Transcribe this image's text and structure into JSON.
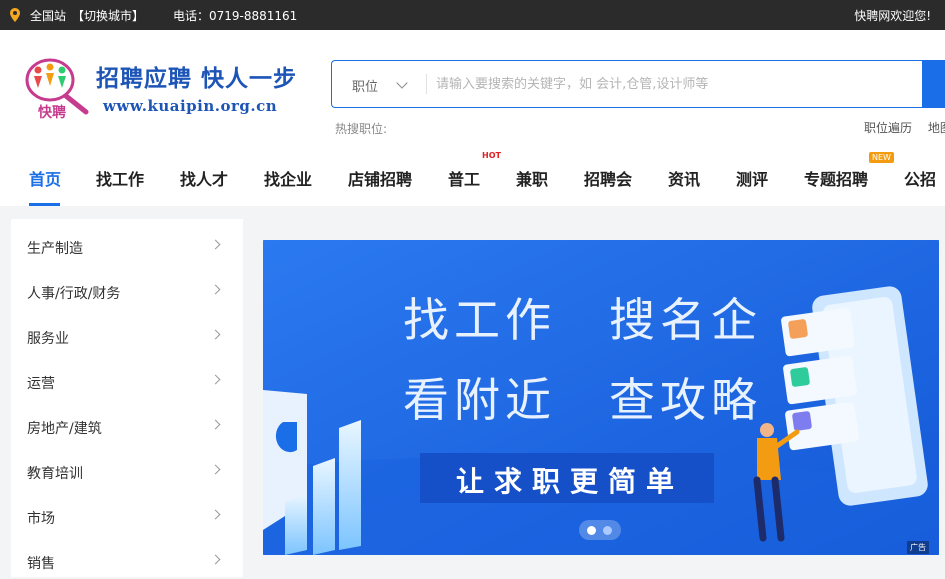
{
  "topbar": {
    "site": "全国站",
    "switch_city": "【切换城市】",
    "phone": "电话：0719-8881161",
    "welcome": "快聘网欢迎您!"
  },
  "brand": {
    "logo_text": "快聘",
    "name": "招聘应聘 快人一步",
    "url": "www.kuaipin.org.cn"
  },
  "search": {
    "type": "职位",
    "placeholder": "请输入要搜索的关键字，如 会计,仓管,设计师等",
    "hot_label": "热搜职位:"
  },
  "quick_links": [
    "职位遍历",
    "地图"
  ],
  "nav": {
    "items": [
      "首页",
      "找工作",
      "找人才",
      "找企业",
      "店铺招聘",
      "普工",
      "兼职",
      "招聘会",
      "资讯",
      "测评",
      "专题招聘",
      "公招"
    ],
    "hot_badge": "HOT",
    "new_badge": "NEW"
  },
  "categories": [
    "生产制造",
    "人事/行政/财务",
    "服务业",
    "运营",
    "房地产/建筑",
    "教育培训",
    "市场",
    "销售"
  ],
  "banner": {
    "line1a": "找工作",
    "line1b": "搜名企",
    "line2a": "看附近",
    "line2b": "查攻略",
    "slogan": "让求职更简单",
    "ad": "广告"
  },
  "colors": {
    "accent": "#1a6ee8",
    "brand_blue": "#1d55b7",
    "banner_bg": "#1f6ee8",
    "topbar_bg": "#2b2b2b"
  }
}
